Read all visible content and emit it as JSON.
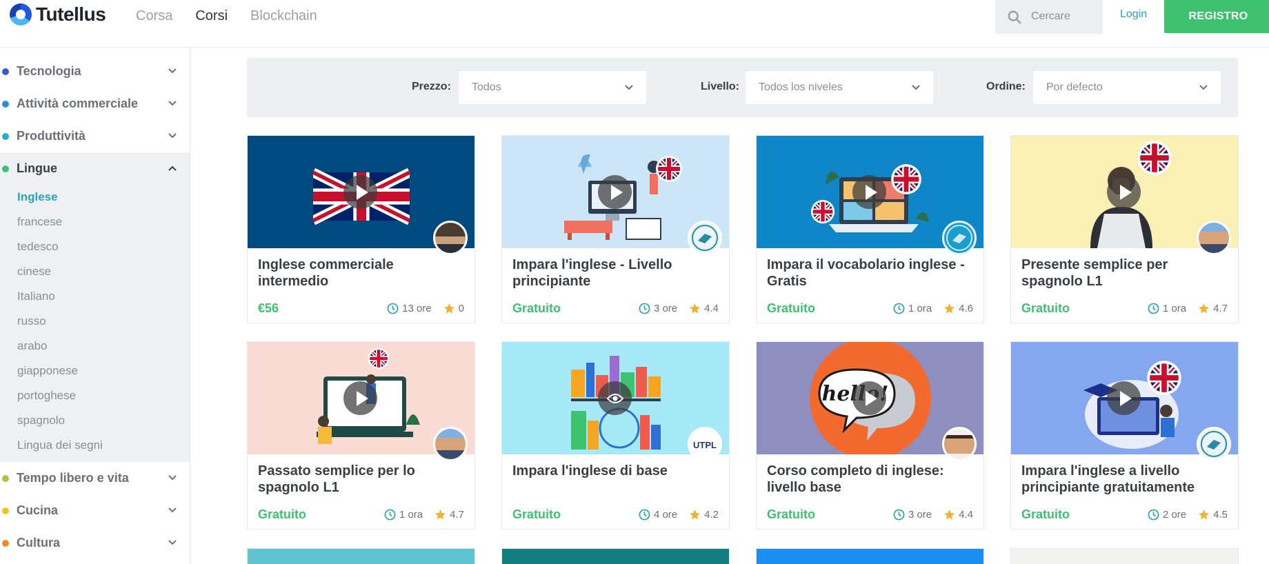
{
  "brand": {
    "name": "Tutellus"
  },
  "nav": {
    "items": [
      "Corsa",
      "Corsi",
      "Blockchain"
    ],
    "active": "Corsi"
  },
  "search": {
    "placeholder": "Cercare"
  },
  "auth": {
    "login": "Login",
    "register": "REGISTRO"
  },
  "colors": {
    "green": "#3ec270",
    "teal": "#2aa4b8"
  },
  "sidebar": {
    "categories": [
      {
        "label": "Tecnologia",
        "dot": "#3b5bcc",
        "open": false
      },
      {
        "label": "Attività commerciale",
        "dot": "#2b8fd6",
        "open": false
      },
      {
        "label": "Produttività",
        "dot": "#1fb0c4",
        "open": false
      },
      {
        "label": "Lingue",
        "dot": "#3ec270",
        "open": true
      },
      {
        "label": "Tempo libero e vita",
        "dot": "#a7c83a",
        "open": false
      },
      {
        "label": "Cucina",
        "dot": "#f2c21b",
        "open": false
      },
      {
        "label": "Cultura",
        "dot": "#f08a24",
        "open": false
      }
    ],
    "subcategories": [
      "Inglese",
      "francese",
      "tedesco",
      "cinese",
      "Italiano",
      "russo",
      "arabo",
      "giapponese",
      "portoghese",
      "spagnolo",
      "Lingua dei segni"
    ],
    "active_sub": "Inglese"
  },
  "filters": {
    "price": {
      "label": "Prezzo:",
      "value": "Todos"
    },
    "level": {
      "label": "Livello:",
      "value": "Todos los niveles"
    },
    "order": {
      "label": "Ordine:",
      "value": "Por defecto"
    }
  },
  "courses": [
    {
      "title": "Inglese commerciale intermedio",
      "price": "€56",
      "duration": "13 ore",
      "rating": "0",
      "thumb_bg": "#004a80",
      "icon": "uk-flag"
    },
    {
      "title": "Impara l'inglese - Livello principiante",
      "price": "Gratuito",
      "duration": "3 ore",
      "rating": "4.4",
      "thumb_bg": "#cde6f7",
      "icon": "study-illustration"
    },
    {
      "title": "Impara il vocabolario inglese - Gratis",
      "price": "Gratuito",
      "duration": "1 ora",
      "rating": "4.6",
      "thumb_bg": "#0f86c8",
      "icon": "laptop-call-illustration"
    },
    {
      "title": "Presente semplice per spagnolo L1",
      "price": "Gratuito",
      "duration": "1 ora",
      "rating": "4.7",
      "thumb_bg": "#fbf0b4",
      "icon": "person-laptop-illustration"
    },
    {
      "title": "Passato semplice per lo spagnolo L1",
      "price": "Gratuito",
      "duration": "1 ora",
      "rating": "4.7",
      "thumb_bg": "#fbdcd4",
      "icon": "online-lesson-illustration"
    },
    {
      "title": "Impara l'inglese di base",
      "price": "Gratuito",
      "duration": "4 ore",
      "rating": "4.2",
      "thumb_bg": "#a5eaf6",
      "icon": "london-illustration"
    },
    {
      "title": "Corso completo di inglese: livello base",
      "price": "Gratuito",
      "duration": "3 ore",
      "rating": "4.4",
      "thumb_bg": "#8e8fbf",
      "icon": "hello-bubble-illustration"
    },
    {
      "title": "Impara l'inglese a livello principiante gratuitamente",
      "price": "Gratuito",
      "duration": "2 ore",
      "rating": "4.5",
      "thumb_bg": "#85a7ef",
      "icon": "graduation-illustration"
    }
  ],
  "partial_row_colors": [
    "#5fc4cf",
    "#147f80",
    "#1a8ef2",
    "#f3f3f1"
  ]
}
